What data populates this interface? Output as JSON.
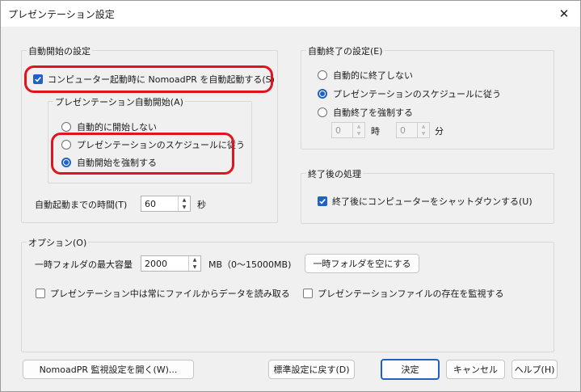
{
  "window": {
    "title": "プレゼンテーション設定",
    "close_glyph": "✕"
  },
  "auto_start": {
    "legend": "自動開始の設定",
    "launch_checkbox": {
      "label": "コンピューター起動時に NomoadPR を自動起動する(S)",
      "checked": true
    },
    "presentation_auto_start": {
      "legend": "プレゼンテーション自動開始(A)",
      "options": [
        {
          "label": "自動的に開始しない",
          "selected": false
        },
        {
          "label": "プレゼンテーションのスケジュールに従う",
          "selected": false
        },
        {
          "label": "自動開始を強制する",
          "selected": true
        }
      ]
    },
    "delay": {
      "label": "自動起動までの時間(T)",
      "value": "60",
      "unit": "秒"
    }
  },
  "auto_end": {
    "legend": "自動終了の設定(E)",
    "options": [
      {
        "label": "自動的に終了しない",
        "selected": false
      },
      {
        "label": "プレゼンテーションのスケジュールに従う",
        "selected": true
      },
      {
        "label": "自動終了を強制する",
        "selected": false
      }
    ],
    "hour": {
      "value": "0",
      "unit": "時"
    },
    "minute": {
      "value": "0",
      "unit": "分"
    }
  },
  "after_end": {
    "legend": "終了後の処理",
    "shutdown_checkbox": {
      "label": "終了後にコンピューターをシャットダウンする(U)",
      "checked": true
    }
  },
  "options": {
    "legend": "オプション(O)",
    "temp_folder": {
      "label": "一時フォルダの最大容量",
      "value": "2000",
      "unit": "MB（0〜15000MB)",
      "clear_button": "一時フォルダを空にする"
    },
    "read_data_checkbox": {
      "label": "プレゼンテーション中は常にファイルからデータを読み取る",
      "checked": false
    },
    "monitor_file_checkbox": {
      "label": "プレゼンテーションファイルの存在を監視する",
      "checked": false
    }
  },
  "buttons": {
    "monitor_settings": "NomoadPR 監視設定を開く(W)...",
    "restore_defaults": "標準設定に戻す(D)",
    "ok": "決定",
    "cancel": "キャンセル",
    "help": "ヘルプ(H)"
  },
  "colors": {
    "accent": "#1f62c7",
    "highlight": "#e0141f"
  }
}
